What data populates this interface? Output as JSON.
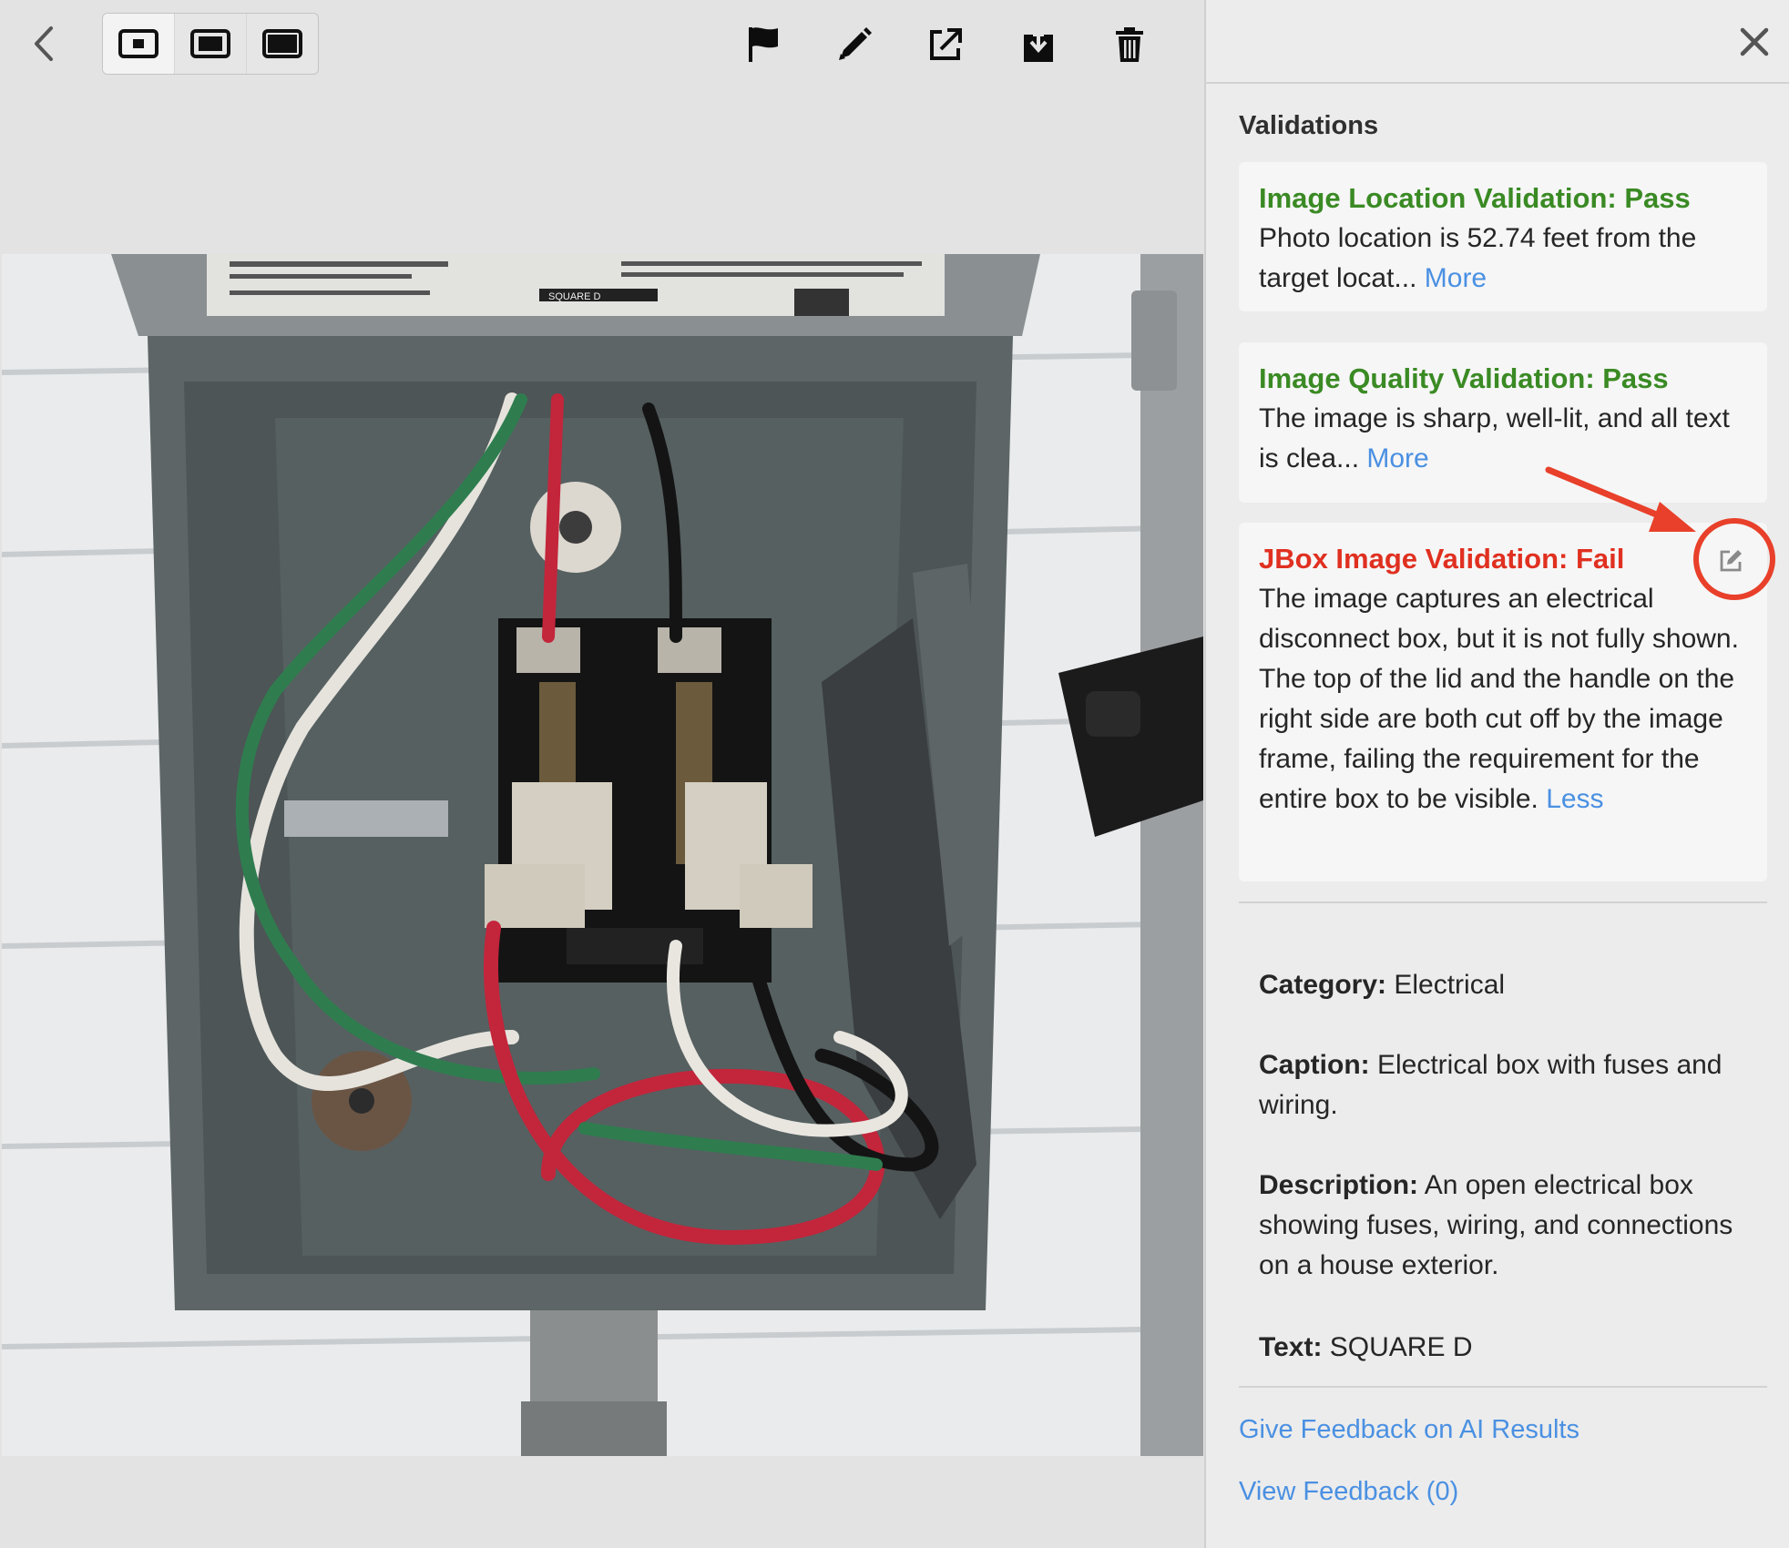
{
  "toolbar": {
    "icons": [
      "back-chevron-icon",
      "size-small-icon",
      "size-medium-icon",
      "size-large-icon",
      "flag-icon",
      "pencil-icon",
      "open-external-icon",
      "download-icon",
      "trash-icon"
    ]
  },
  "panel": {
    "section_title": "Validations",
    "validations": [
      {
        "title": "Image Location Validation: Pass",
        "status": "pass",
        "body": "Photo location is 52.74 feet from the target locat... ",
        "toggle": "More"
      },
      {
        "title": "Image Quality Validation: Pass",
        "status": "pass",
        "body": "The image is sharp, well-lit, and all text is clea... ",
        "toggle": "More"
      },
      {
        "title": "JBox Image Validation: Fail",
        "status": "fail",
        "body": "The image captures an electrical disconnect box, but it is not fully shown. The top of the lid and the handle on the right side are both cut off by the image frame, failing the requirement for the entire box to be visible. ",
        "toggle": "Less"
      }
    ],
    "meta": {
      "category_label": "Category:",
      "category_value": " Electrical",
      "caption_label": "Caption:",
      "caption_value": " Electrical box with fuses and wiring.",
      "description_label": "Description:",
      "description_value": " An open electrical box showing fuses, wiring, and connections on a house exterior.",
      "text_label": "Text:",
      "text_value": " SQUARE D"
    },
    "links": {
      "feedback": "Give Feedback on AI Results",
      "view_feedback": "View Feedback (0)"
    }
  },
  "photo": {
    "label_text": "SQUARE D"
  },
  "colors": {
    "pass": "#3a8a24",
    "fail": "#e03020",
    "link": "#4a90e2",
    "annotation": "#e8402a"
  }
}
